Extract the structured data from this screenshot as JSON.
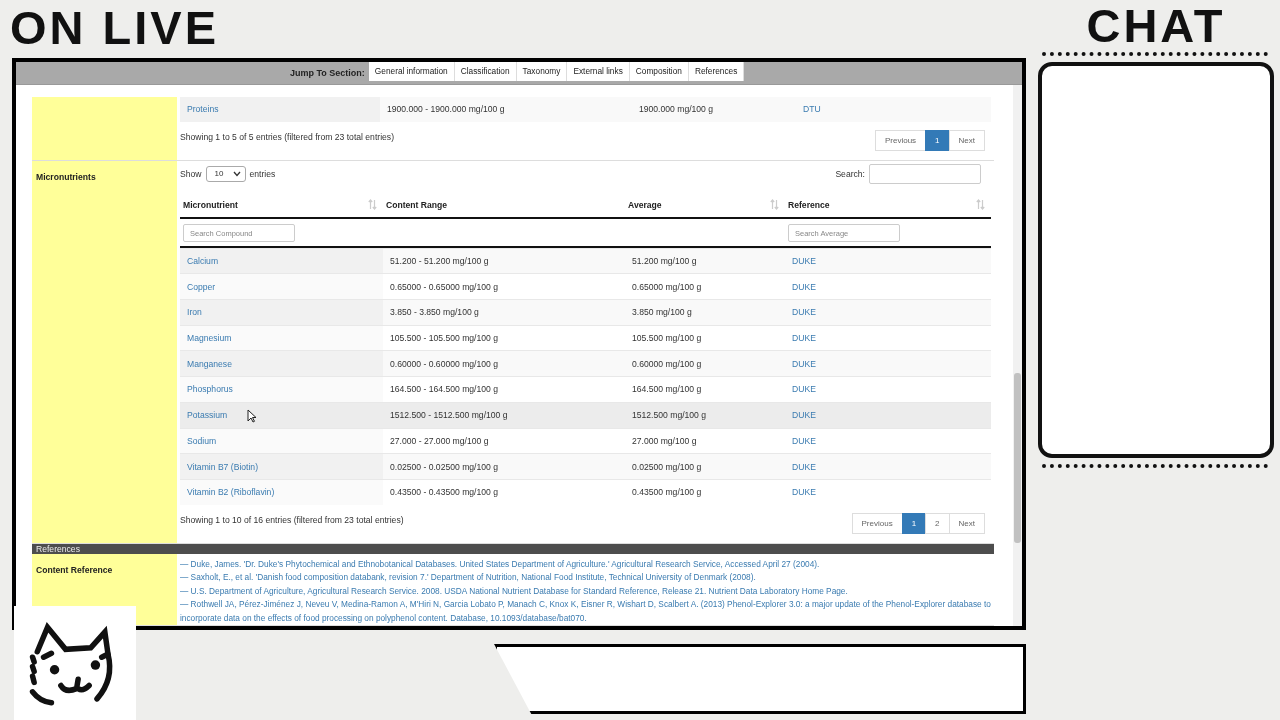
{
  "overlay": {
    "live_title": "ON LIVE",
    "chat_title": "CHAT"
  },
  "jump_bar": {
    "label": "Jump To Section:",
    "links": [
      "General information",
      "Classification",
      "Taxonomy",
      "External links",
      "Composition",
      "References"
    ]
  },
  "macronutrients_tail": {
    "rows": [
      {
        "name": "Proteins",
        "content_range": "1900.000 - 1900.000 mg/100 g",
        "average": "1900.000 mg/100 g",
        "reference": "DTU",
        "hovered": false
      }
    ],
    "info": "Showing 1 to 5 of 5 entries (filtered from 23 total entries)",
    "pagination": [
      {
        "label": "Previous",
        "selected": false
      },
      {
        "label": "1",
        "selected": true
      },
      {
        "label": "Next",
        "selected": false
      }
    ]
  },
  "micronutrients": {
    "label": "Micronutrients",
    "length_before": "Show",
    "length_value": "10",
    "length_after": "entries",
    "search_label": "Search:",
    "columns": [
      {
        "label": "Micronutrient",
        "sortable": true,
        "filter_placeholder": "Search Compound"
      },
      {
        "label": "Content Range",
        "sortable": false
      },
      {
        "label": "Average",
        "sortable": true
      },
      {
        "label": "Reference",
        "sortable": true,
        "filter_placeholder": "Search Average"
      }
    ],
    "rows": [
      {
        "name": "Calcium",
        "content_range": "51.200 - 51.200 mg/100 g",
        "average": "51.200 mg/100 g",
        "reference": "DUKE",
        "hovered": false
      },
      {
        "name": "Copper",
        "content_range": "0.65000 - 0.65000 mg/100 g",
        "average": "0.65000 mg/100 g",
        "reference": "DUKE",
        "hovered": false
      },
      {
        "name": "Iron",
        "content_range": "3.850 - 3.850 mg/100 g",
        "average": "3.850 mg/100 g",
        "reference": "DUKE",
        "hovered": false
      },
      {
        "name": "Magnesium",
        "content_range": "105.500 - 105.500 mg/100 g",
        "average": "105.500 mg/100 g",
        "reference": "DUKE",
        "hovered": false
      },
      {
        "name": "Manganese",
        "content_range": "0.60000 - 0.60000 mg/100 g",
        "average": "0.60000 mg/100 g",
        "reference": "DUKE",
        "hovered": false
      },
      {
        "name": "Phosphorus",
        "content_range": "164.500 - 164.500 mg/100 g",
        "average": "164.500 mg/100 g",
        "reference": "DUKE",
        "hovered": false
      },
      {
        "name": "Potassium",
        "content_range": "1512.500 - 1512.500 mg/100 g",
        "average": "1512.500 mg/100 g",
        "reference": "DUKE",
        "hovered": true
      },
      {
        "name": "Sodium",
        "content_range": "27.000 - 27.000 mg/100 g",
        "average": "27.000 mg/100 g",
        "reference": "DUKE",
        "hovered": false
      },
      {
        "name": "Vitamin B7 (Biotin)",
        "content_range": "0.02500 - 0.02500 mg/100 g",
        "average": "0.02500 mg/100 g",
        "reference": "DUKE",
        "hovered": false
      },
      {
        "name": "Vitamin B2 (Riboflavin)",
        "content_range": "0.43500 - 0.43500 mg/100 g",
        "average": "0.43500 mg/100 g",
        "reference": "DUKE",
        "hovered": false
      }
    ],
    "info": "Showing 1 to 10 of 16 entries (filtered from 23 total entries)",
    "pagination": [
      {
        "label": "Previous",
        "selected": false
      },
      {
        "label": "1",
        "selected": true
      },
      {
        "label": "2",
        "selected": false
      },
      {
        "label": "Next",
        "selected": false
      }
    ]
  },
  "references": {
    "header": "References",
    "label": "Content Reference",
    "entries": [
      "— Duke, James. 'Dr. Duke's Phytochemical and Ethnobotanical Databases. United States Department of Agriculture.' Agricultural Research Service, Accessed April 27 (2004).",
      "— Saxholt, E., et al. 'Danish food composition databank, revision 7.' Department of Nutrition, National Food Institute, Technical University of Denmark (2008).",
      "— U.S. Department of Agriculture, Agricultural Research Service. 2008. USDA National Nutrient Database for Standard Reference, Release 21. Nutrient Data Laboratory Home Page.",
      "— Rothwell JA, Pérez-Jiménez J, Neveu V, Medina-Ramon A, M'Hiri N, Garcia Lobato P, Manach C, Knox K, Eisner R, Wishart D, Scalbert A. (2013) Phenol-Explorer 3.0: a major update of the Phenol-Explorer database to incorporate data on the effects of food processing on polyphenol content. Database, 10.1093/database/bat070."
    ]
  }
}
